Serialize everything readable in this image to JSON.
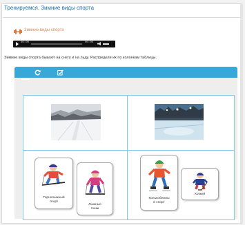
{
  "page": {
    "title": "Тренируемся. Зимние виды спорта"
  },
  "section": {
    "icon": "dumbbell-icon",
    "title": "Зимние виды спорта",
    "accent_color": "#d98a55"
  },
  "audio_player": {
    "time_start": "00:00",
    "time_end": "00:00"
  },
  "task": {
    "instruction": "Зимние виды спорта бывают на снегу и на льду. Распредели их по колонкам таблицы.",
    "toolbar_color": "#3aa7d9",
    "toolbar": [
      {
        "icon": "refresh-icon"
      },
      {
        "icon": "check-icon"
      }
    ],
    "columns": [
      {
        "image": "snow-slope-photo"
      },
      {
        "image": "ice-rink-photo"
      }
    ],
    "cards": [
      {
        "label_line1": "Горнолыжный",
        "label_line2": "спорт"
      },
      {
        "label_line1": "Лыжные",
        "label_line2": "гонки"
      },
      {
        "label_line1": "Конькобежны",
        "label_line2": "й спорт"
      },
      {
        "label_line1": "Хоккей",
        "label_line2": ""
      }
    ]
  }
}
